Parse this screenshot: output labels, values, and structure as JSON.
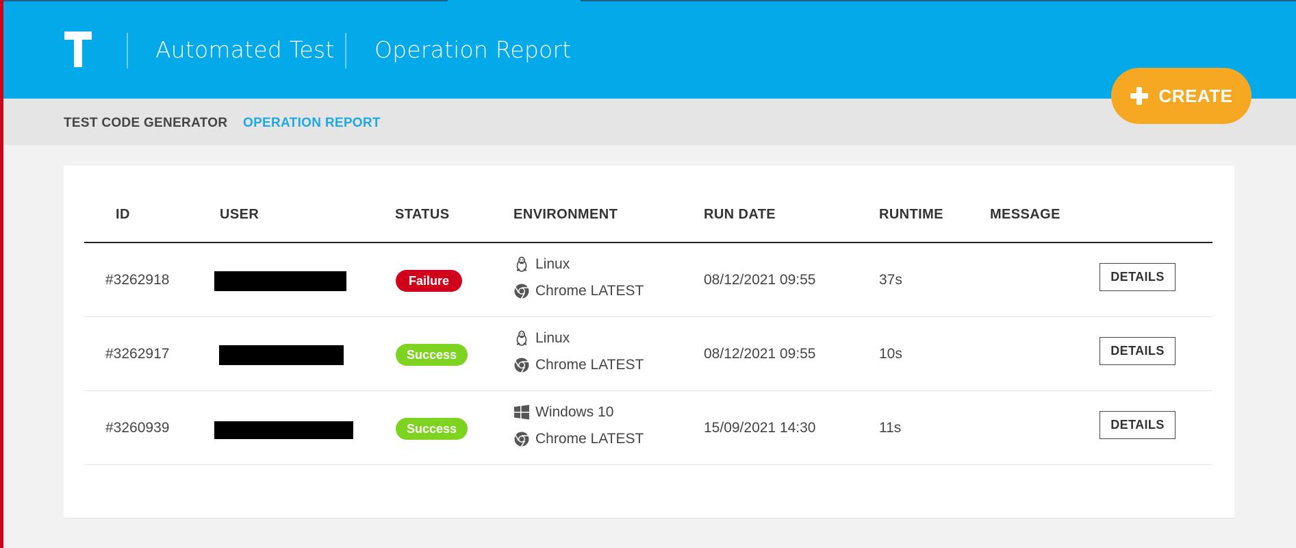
{
  "header": {
    "logo_letter": "T",
    "app_title": "Automated Test",
    "section_title": "Operation Report"
  },
  "create_button": {
    "label": "CREATE",
    "icon": "plus-icon"
  },
  "nav": {
    "items": [
      {
        "label": "TEST CODE GENERATOR",
        "active": false
      },
      {
        "label": "OPERATION REPORT",
        "active": true
      }
    ]
  },
  "table": {
    "columns": [
      "ID",
      "USER",
      "STATUS",
      "ENVIRONMENT",
      "RUN DATE",
      "RUNTIME",
      "MESSAGE"
    ],
    "rows": [
      {
        "id": "#3262918",
        "user": "[redacted]",
        "status": "Failure",
        "os": "Linux",
        "os_icon": "linux-icon",
        "browser": "Chrome LATEST",
        "browser_icon": "chrome-icon",
        "run_date": "08/12/2021 09:55",
        "runtime": "37s",
        "message": "",
        "action": "DETAILS"
      },
      {
        "id": "#3262917",
        "user": "[redacted]",
        "status": "Success",
        "os": "Linux",
        "os_icon": "linux-icon",
        "browser": "Chrome LATEST",
        "browser_icon": "chrome-icon",
        "run_date": "08/12/2021 09:55",
        "runtime": "10s",
        "message": "",
        "action": "DETAILS"
      },
      {
        "id": "#3260939",
        "user": "[redacted]",
        "status": "Success",
        "os": "Windows 10",
        "os_icon": "windows-icon",
        "browser": "Chrome LATEST",
        "browser_icon": "chrome-icon",
        "run_date": "15/09/2021 14:30",
        "runtime": "11s",
        "message": "",
        "action": "DETAILS"
      }
    ]
  },
  "colors": {
    "header_bg": "#03a9e8",
    "accent_orange": "#f7a823",
    "failure": "#d0021b",
    "success": "#7ed321",
    "nav_active": "#1ea8e6"
  }
}
